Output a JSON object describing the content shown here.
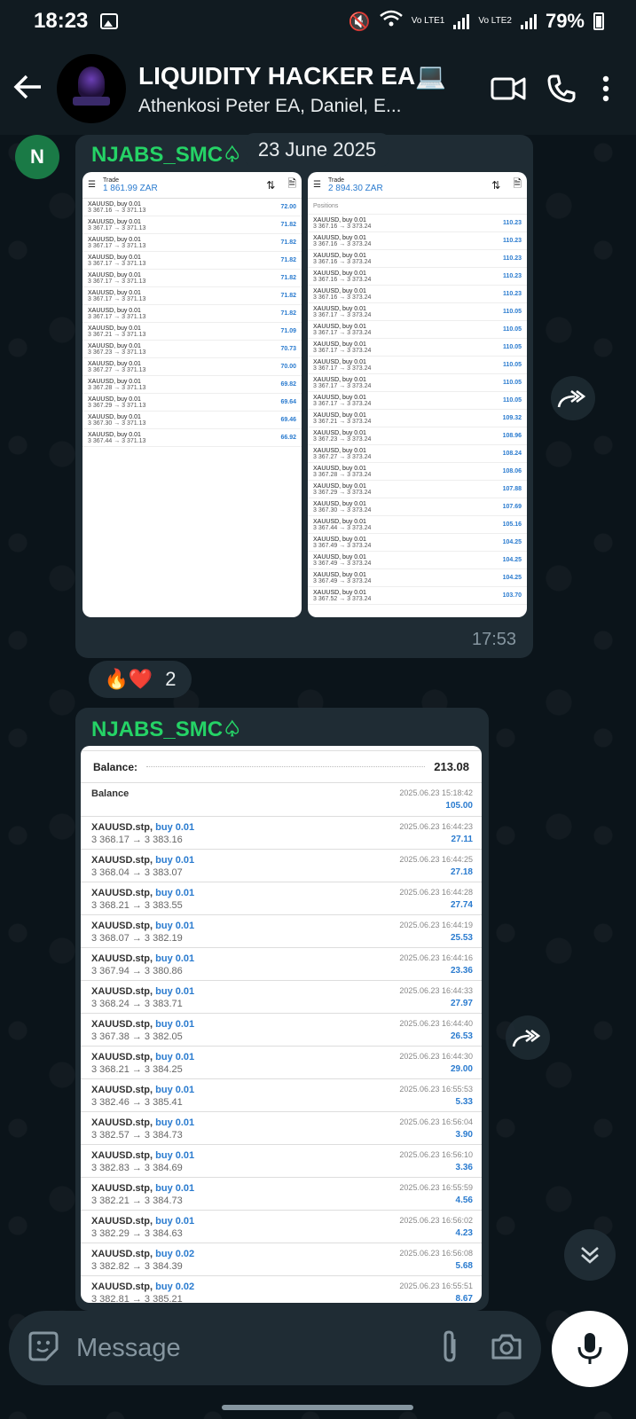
{
  "status_bar": {
    "time": "18:23",
    "battery": "79%",
    "lte1": "Vo LTE1",
    "lte2": "Vo LTE2"
  },
  "header": {
    "title": "LIQUIDITY HACKER EA💻",
    "subtitle": "Athenkosi Peter EA, Daniel, E..."
  },
  "date_chip": "23 June 2025",
  "sender_initial": "N",
  "message1": {
    "sender": "NJABS_SMC♤",
    "time": "17:53",
    "shot_left": {
      "title": "Trade",
      "balance": "1 861.99 ZAR",
      "rows": [
        {
          "sym": "XAUUSD, buy 0.01",
          "px": "3 367.16 → 3 371.13",
          "v": "72.00"
        },
        {
          "sym": "XAUUSD, buy 0.01",
          "px": "3 367.17 → 3 371.13",
          "v": "71.82"
        },
        {
          "sym": "XAUUSD, buy 0.01",
          "px": "3 367.17 → 3 371.13",
          "v": "71.82"
        },
        {
          "sym": "XAUUSD, buy 0.01",
          "px": "3 367.17 → 3 371.13",
          "v": "71.82"
        },
        {
          "sym": "XAUUSD, buy 0.01",
          "px": "3 367.17 → 3 371.13",
          "v": "71.82"
        },
        {
          "sym": "XAUUSD, buy 0.01",
          "px": "3 367.17 → 3 371.13",
          "v": "71.82"
        },
        {
          "sym": "XAUUSD, buy 0.01",
          "px": "3 367.17 → 3 371.13",
          "v": "71.82"
        },
        {
          "sym": "XAUUSD, buy 0.01",
          "px": "3 367.21 → 3 371.13",
          "v": "71.09"
        },
        {
          "sym": "XAUUSD, buy 0.01",
          "px": "3 367.23 → 3 371.13",
          "v": "70.73"
        },
        {
          "sym": "XAUUSD, buy 0.01",
          "px": "3 367.27 → 3 371.13",
          "v": "70.00"
        },
        {
          "sym": "XAUUSD, buy 0.01",
          "px": "3 367.28 → 3 371.13",
          "v": "69.82"
        },
        {
          "sym": "XAUUSD, buy 0.01",
          "px": "3 367.29 → 3 371.13",
          "v": "69.64"
        },
        {
          "sym": "XAUUSD, buy 0.01",
          "px": "3 367.30 → 3 371.13",
          "v": "69.46"
        },
        {
          "sym": "XAUUSD, buy 0.01",
          "px": "3 367.44 → 3 371.13",
          "v": "66.92"
        }
      ]
    },
    "shot_right": {
      "title": "Trade",
      "balance": "2 894.30 ZAR",
      "section": "Positions",
      "rows": [
        {
          "sym": "XAUUSD, buy 0.01",
          "px": "3 367.16 → 3 373.24",
          "v": "110.23"
        },
        {
          "sym": "XAUUSD, buy 0.01",
          "px": "3 367.16 → 3 373.24",
          "v": "110.23"
        },
        {
          "sym": "XAUUSD, buy 0.01",
          "px": "3 367.16 → 3 373.24",
          "v": "110.23"
        },
        {
          "sym": "XAUUSD, buy 0.01",
          "px": "3 367.16 → 3 373.24",
          "v": "110.23"
        },
        {
          "sym": "XAUUSD, buy 0.01",
          "px": "3 367.16 → 3 373.24",
          "v": "110.23"
        },
        {
          "sym": "XAUUSD, buy 0.01",
          "px": "3 367.17 → 3 373.24",
          "v": "110.05"
        },
        {
          "sym": "XAUUSD, buy 0.01",
          "px": "3 367.17 → 3 373.24",
          "v": "110.05"
        },
        {
          "sym": "XAUUSD, buy 0.01",
          "px": "3 367.17 → 3 373.24",
          "v": "110.05"
        },
        {
          "sym": "XAUUSD, buy 0.01",
          "px": "3 367.17 → 3 373.24",
          "v": "110.05"
        },
        {
          "sym": "XAUUSD, buy 0.01",
          "px": "3 367.17 → 3 373.24",
          "v": "110.05"
        },
        {
          "sym": "XAUUSD, buy 0.01",
          "px": "3 367.17 → 3 373.24",
          "v": "110.05"
        },
        {
          "sym": "XAUUSD, buy 0.01",
          "px": "3 367.21 → 3 373.24",
          "v": "109.32"
        },
        {
          "sym": "XAUUSD, buy 0.01",
          "px": "3 367.23 → 3 373.24",
          "v": "108.96"
        },
        {
          "sym": "XAUUSD, buy 0.01",
          "px": "3 367.27 → 3 373.24",
          "v": "108.24"
        },
        {
          "sym": "XAUUSD, buy 0.01",
          "px": "3 367.28 → 3 373.24",
          "v": "108.06"
        },
        {
          "sym": "XAUUSD, buy 0.01",
          "px": "3 367.29 → 3 373.24",
          "v": "107.88"
        },
        {
          "sym": "XAUUSD, buy 0.01",
          "px": "3 367.30 → 3 373.24",
          "v": "107.69"
        },
        {
          "sym": "XAUUSD, buy 0.01",
          "px": "3 367.44 → 3 373.24",
          "v": "105.16"
        },
        {
          "sym": "XAUUSD, buy 0.01",
          "px": "3 367.49 → 3 373.24",
          "v": "104.25"
        },
        {
          "sym": "XAUUSD, buy 0.01",
          "px": "3 367.49 → 3 373.24",
          "v": "104.25"
        },
        {
          "sym": "XAUUSD, buy 0.01",
          "px": "3 367.49 → 3 373.24",
          "v": "104.25"
        },
        {
          "sym": "XAUUSD, buy 0.01",
          "px": "3 367.52 → 3 373.24",
          "v": "103.70"
        }
      ]
    }
  },
  "reactions": {
    "emojis": "🔥❤️",
    "count": "2"
  },
  "message2": {
    "sender": "NJABS_SMC♤",
    "balance_label": "Balance:",
    "balance_value": "213.08",
    "group": {
      "label": "Balance",
      "date": "2025.06.23 15:18:42",
      "value": "105.00"
    },
    "trades": [
      {
        "sym": "XAUUSD.stp,",
        "side": "buy 0.01",
        "px": "3 368.17 → 3 383.16",
        "date": "2025.06.23 16:44:23",
        "profit": "27.11"
      },
      {
        "sym": "XAUUSD.stp,",
        "side": "buy 0.01",
        "px": "3 368.04 → 3 383.07",
        "date": "2025.06.23 16:44:25",
        "profit": "27.18"
      },
      {
        "sym": "XAUUSD.stp,",
        "side": "buy 0.01",
        "px": "3 368.21 → 3 383.55",
        "date": "2025.06.23 16:44:28",
        "profit": "27.74"
      },
      {
        "sym": "XAUUSD.stp,",
        "side": "buy 0.01",
        "px": "3 368.07 → 3 382.19",
        "date": "2025.06.23 16:44:19",
        "profit": "25.53"
      },
      {
        "sym": "XAUUSD.stp,",
        "side": "buy 0.01",
        "px": "3 367.94 → 3 380.86",
        "date": "2025.06.23 16:44:16",
        "profit": "23.36"
      },
      {
        "sym": "XAUUSD.stp,",
        "side": "buy 0.01",
        "px": "3 368.24 → 3 383.71",
        "date": "2025.06.23 16:44:33",
        "profit": "27.97"
      },
      {
        "sym": "XAUUSD.stp,",
        "side": "buy 0.01",
        "px": "3 367.38 → 3 382.05",
        "date": "2025.06.23 16:44:40",
        "profit": "26.53"
      },
      {
        "sym": "XAUUSD.stp,",
        "side": "buy 0.01",
        "px": "3 368.21 → 3 384.25",
        "date": "2025.06.23 16:44:30",
        "profit": "29.00"
      },
      {
        "sym": "XAUUSD.stp,",
        "side": "buy 0.01",
        "px": "3 382.46 → 3 385.41",
        "date": "2025.06.23 16:55:53",
        "profit": "5.33"
      },
      {
        "sym": "XAUUSD.stp,",
        "side": "buy 0.01",
        "px": "3 382.57 → 3 384.73",
        "date": "2025.06.23 16:56:04",
        "profit": "3.90"
      },
      {
        "sym": "XAUUSD.stp,",
        "side": "buy 0.01",
        "px": "3 382.83 → 3 384.69",
        "date": "2025.06.23 16:56:10",
        "profit": "3.36"
      },
      {
        "sym": "XAUUSD.stp,",
        "side": "buy 0.01",
        "px": "3 382.21 → 3 384.73",
        "date": "2025.06.23 16:55:59",
        "profit": "4.56"
      },
      {
        "sym": "XAUUSD.stp,",
        "side": "buy 0.01",
        "px": "3 382.29 → 3 384.63",
        "date": "2025.06.23 16:56:02",
        "profit": "4.23"
      },
      {
        "sym": "XAUUSD.stp,",
        "side": "buy 0.02",
        "px": "3 382.82 → 3 384.39",
        "date": "2025.06.23 16:56:08",
        "profit": "5.68"
      },
      {
        "sym": "XAUUSD.stp,",
        "side": "buy 0.02",
        "px": "3 382.81 → 3 385.21",
        "date": "2025.06.23 16:55:51",
        "profit": "8.67"
      }
    ]
  },
  "input": {
    "placeholder": "Message"
  },
  "colors": {
    "accent": "#25d366",
    "bubble": "#1f2c34",
    "link_blue": "#2a7bcf"
  }
}
